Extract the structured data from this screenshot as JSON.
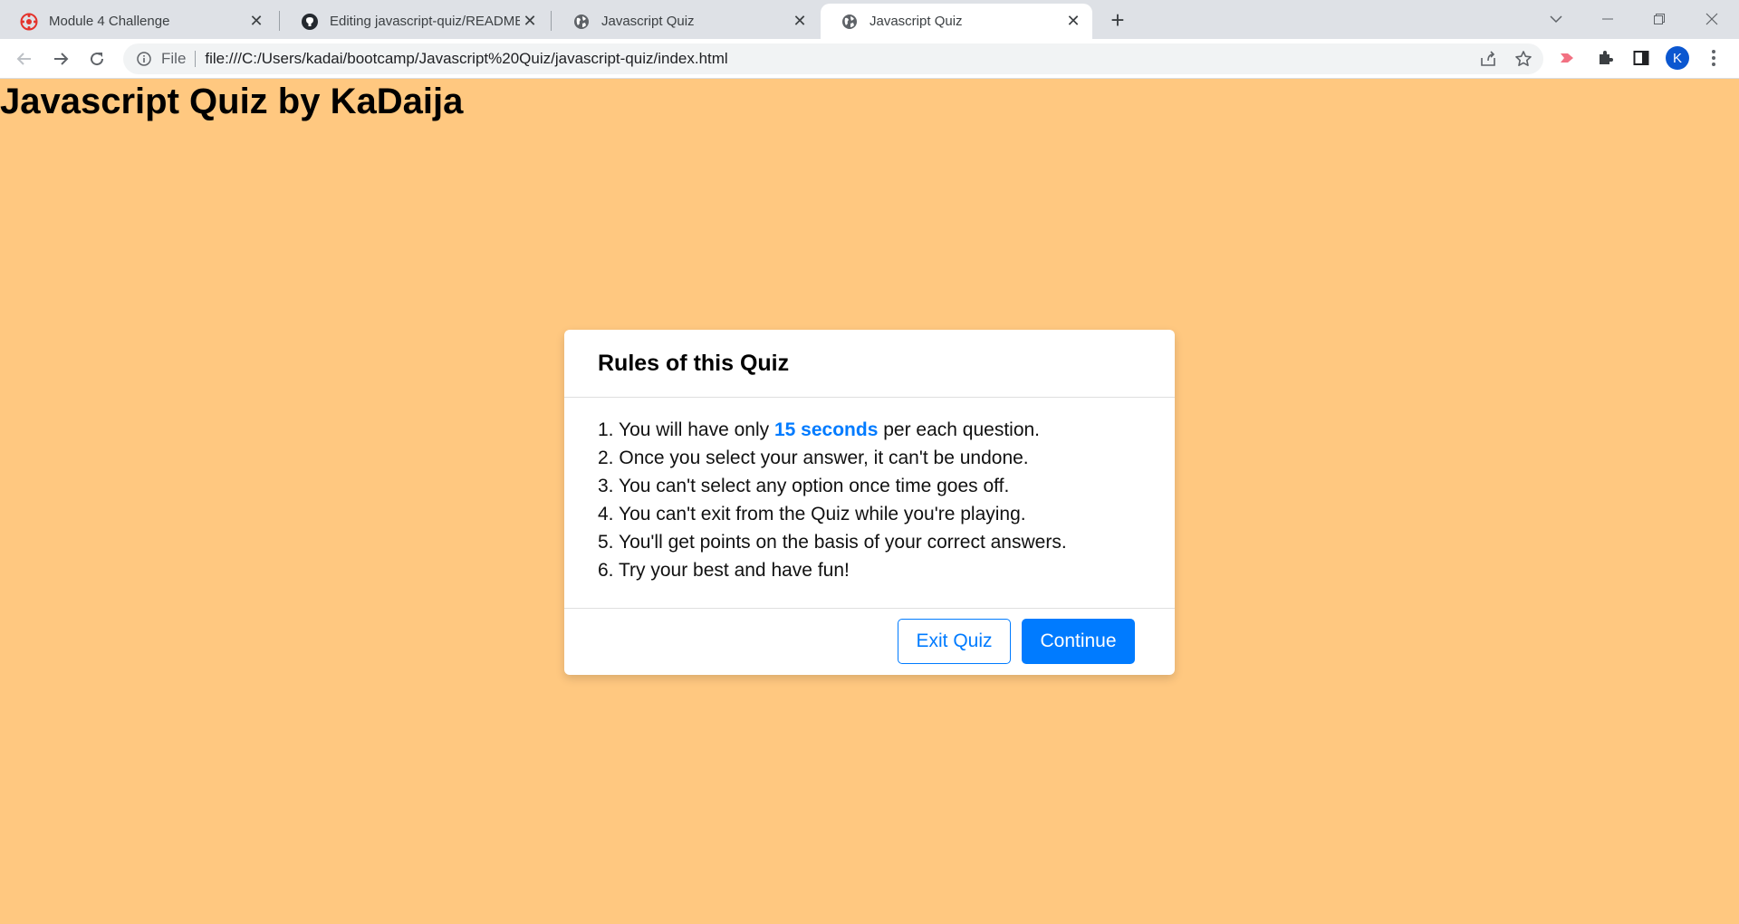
{
  "browser": {
    "tabs": [
      {
        "title": "Module 4 Challenge",
        "icon": "canvas-logo-icon",
        "active": false
      },
      {
        "title": "Editing javascript-quiz/README.md",
        "icon": "github-icon",
        "active": false
      },
      {
        "title": "Javascript Quiz",
        "icon": "globe-icon",
        "active": false
      },
      {
        "title": "Javascript Quiz",
        "icon": "globe-icon",
        "active": true
      }
    ],
    "address": {
      "scheme_label": "File",
      "url": "file:///C:/Users/kadai/bootcamp/Javascript%20Quiz/javascript-quiz/index.html"
    },
    "profile_initial": "K"
  },
  "page": {
    "title": "Javascript Quiz by KaDaija"
  },
  "dialog": {
    "title": "Rules of this Quiz",
    "rules": [
      {
        "number": "1.",
        "before": "You will have only ",
        "highlight": "15 seconds",
        "after": " per each question."
      },
      {
        "number": "2.",
        "text": "Once you select your answer, it can't be undone."
      },
      {
        "number": "3.",
        "text": "You can't select any option once time goes off."
      },
      {
        "number": "4.",
        "text": "You can't exit from the Quiz while you're playing."
      },
      {
        "number": "5.",
        "text": "You'll get points on the basis of your correct answers."
      },
      {
        "number": "6.",
        "text": "Try your best and have fun!"
      }
    ],
    "exit_label": "Exit Quiz",
    "continue_label": "Continue"
  },
  "colors": {
    "page_background": "#ffc880",
    "accent": "#007bff"
  }
}
